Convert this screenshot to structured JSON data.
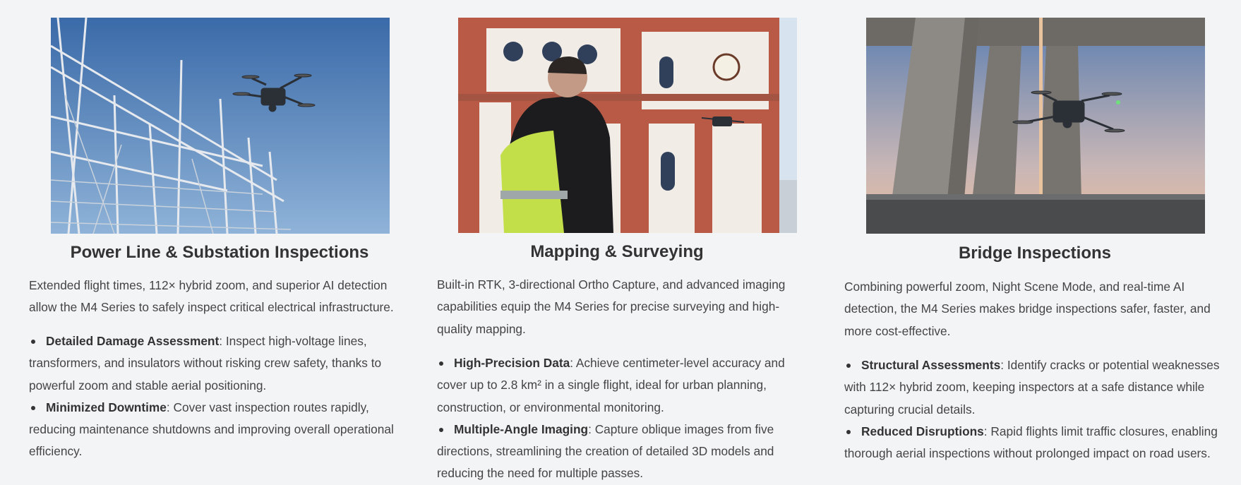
{
  "cards": [
    {
      "title": "Power Line & Substation Inspections",
      "description": "Extended flight times, 112× hybrid zoom, and superior AI detection allow the M4 Series to safely inspect critical electrical infrastructure.",
      "features": [
        {
          "label": "Detailed Damage Assessment",
          "text": ": Inspect high-voltage lines, transformers, and insulators without risking crew safety, thanks to powerful zoom and stable aerial positioning."
        },
        {
          "label": "Minimized Downtime",
          "text": ": Cover vast inspection routes rapidly, reducing maintenance shutdowns and improving overall operational efficiency."
        }
      ]
    },
    {
      "title": "Mapping & Surveying",
      "description": "Built-in RTK, 3-directional Ortho Capture, and advanced imaging capabilities equip the M4 Series for precise surveying and high-quality mapping.",
      "features": [
        {
          "label": "High-Precision Data",
          "text": ": Achieve centimeter-level accuracy and cover up to 2.8 km² in a single flight, ideal for urban planning, construction, or environmental monitoring."
        },
        {
          "label": "Multiple-Angle Imaging",
          "text": ": Capture oblique images from five directions, streamlining the creation of detailed 3D models and reducing the need for multiple passes."
        }
      ]
    },
    {
      "title": "Bridge Inspections",
      "description": "Combining powerful zoom, Night Scene Mode, and real-time AI detection, the M4 Series makes bridge inspections safer, faster, and more cost-effective.",
      "features": [
        {
          "label": "Structural Assessments",
          "text": ": Identify cracks or potential weaknesses with 112× hybrid zoom, keeping inspectors at a safe distance while capturing crucial details."
        },
        {
          "label": "Reduced Disruptions",
          "text": ": Rapid flights limit traffic closures, enabling thorough aerial inspections without prolonged impact on road users."
        }
      ]
    }
  ]
}
